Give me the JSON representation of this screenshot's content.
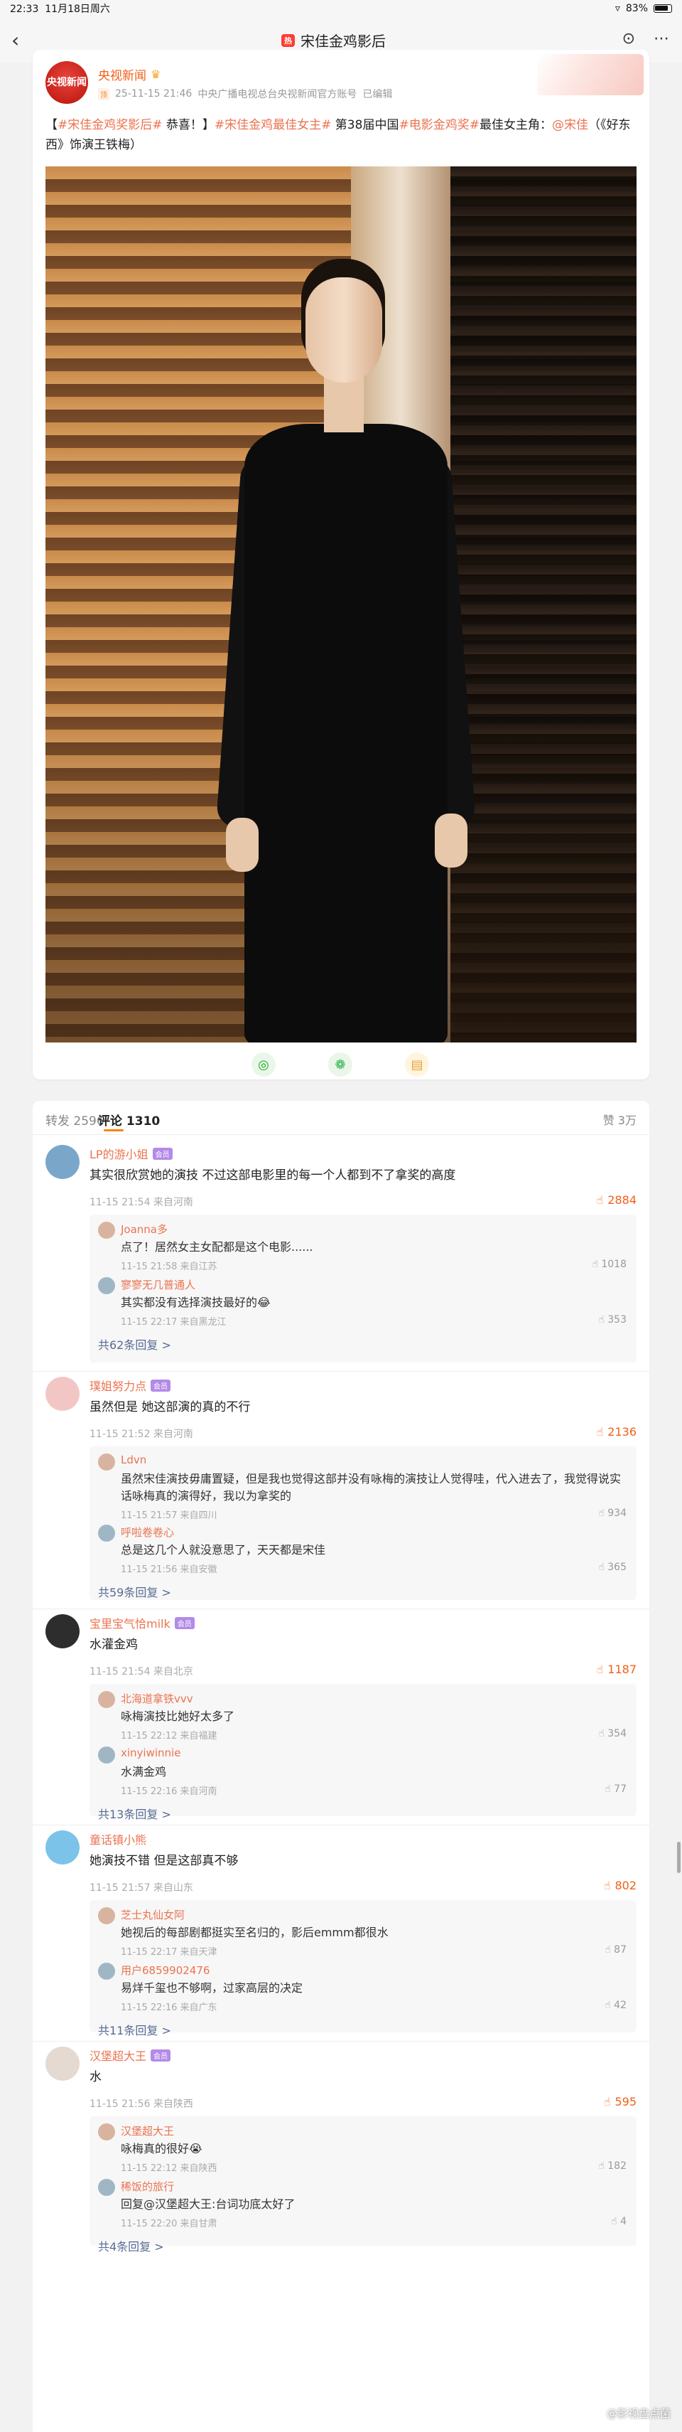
{
  "status_bar": {
    "time": "22:33",
    "date": "11月18日周六",
    "battery": "83%"
  },
  "nav": {
    "hot_badge": "热",
    "title": "宋佳金鸡影后",
    "back_icon": "chevron-left-icon"
  },
  "post": {
    "author": "央视新闻",
    "avatar_text": "央视新闻",
    "top_tag": "顶",
    "meta_time": "25-11-15 21:46",
    "meta_source": "中央广播电视总台央视新闻官方账号",
    "meta_edited": "已编辑",
    "text_parts": [
      {
        "t": "【",
        "c": "plain"
      },
      {
        "t": "#宋佳金鸡奖影后#",
        "c": "tag"
      },
      {
        "t": " 恭喜！】",
        "c": "plain"
      },
      {
        "t": "#宋佳金鸡最佳女主#",
        "c": "tag"
      },
      {
        "t": " 第38届中国",
        "c": "plain"
      },
      {
        "t": "#电影金鸡奖#",
        "c": "tag"
      },
      {
        "t": "最佳女主角：",
        "c": "plain"
      },
      {
        "t": "@宋佳",
        "c": "mention"
      },
      {
        "t": "（《好东西》饰演王铁梅）",
        "c": "plain"
      }
    ]
  },
  "comments_header": {
    "reposts": "转发 2596",
    "comments": "评论 1310",
    "likes": "赞 3万"
  },
  "comments": [
    {
      "name": "LP的游小姐",
      "badge": "会员",
      "text": "其实很欣赏她的演技 不过这部电影里的每一个人都到不了拿奖的高度",
      "meta": "11-15 21:54 来自河南",
      "likes": "2884",
      "replies": [
        {
          "name": "Joanna多",
          "text": "点了！居然女主女配都是这个电影......",
          "meta": "11-15 21:58 来自江苏",
          "likes": "1018"
        },
        {
          "name": "寥寥无几普通人",
          "text": "其实都没有选择演技最好的😂",
          "meta": "11-15 22:17 来自黑龙江",
          "likes": "353"
        }
      ],
      "more": "共62条回复 >"
    },
    {
      "name": "璞姐努力点",
      "badge": "会员",
      "text": "虽然但是 她这部演的真的不行",
      "meta": "11-15 21:52 来自河南",
      "likes": "2136",
      "replies": [
        {
          "name": "Ldvn",
          "text": "虽然宋佳演技毋庸置疑，但是我也觉得这部并没有咏梅的演技让人觉得哇，代入进去了，我觉得说实话咏梅真的演得好，我以为拿奖的",
          "meta": "11-15 21:57 来自四川",
          "likes": "934"
        },
        {
          "name": "呼啦卷卷心",
          "text": "总是这几个人就没意思了，天天都是宋佳",
          "meta": "11-15 21:56 来自安徽",
          "likes": "365"
        }
      ],
      "more": "共59条回复 >"
    },
    {
      "name": "宝里宝气恰milk",
      "badge": "会员",
      "text": "水灌金鸡",
      "meta": "11-15 21:54 来自北京",
      "likes": "1187",
      "replies": [
        {
          "name": "北海道拿铁vvv",
          "text": "咏梅演技比她好太多了",
          "meta": "11-15 22:12 来自福建",
          "likes": "354"
        },
        {
          "name": "xinyiwinnie",
          "text": "水满金鸡",
          "meta": "11-15 22:16 来自河南",
          "likes": "77"
        }
      ],
      "more": "共13条回复 >"
    },
    {
      "name": "童话镇小熊",
      "text": "她演技不错 但是这部真不够",
      "meta": "11-15 21:57 来自山东",
      "likes": "802",
      "replies": [
        {
          "name": "芝士丸仙女阿",
          "text": "她视后的每部剧都挺实至名归的，影后emmm都很水",
          "meta": "11-15 22:17 来自天津",
          "likes": "87"
        },
        {
          "name": "用户6859902476",
          "text": "易烊千玺也不够啊，过家高层的决定",
          "meta": "11-15 22:16 来自广东",
          "likes": "42"
        }
      ],
      "more": "共11条回复 >"
    },
    {
      "name": "汉堡超大王",
      "badge": "会员",
      "text": "水",
      "meta": "11-15 21:56 来自陕西",
      "likes": "595",
      "replies": [
        {
          "name": "汉堡超大王",
          "text": "咏梅真的很好😭",
          "meta": "11-15 22:12 来自陕西",
          "likes": "182"
        },
        {
          "name": "稀饭的旅行",
          "text": "回复@汉堡超大王:台词功底太好了",
          "meta": "11-15 22:20 来自甘肃",
          "likes": "4"
        }
      ],
      "more": "共4条回复 >"
    }
  ],
  "watermark": "@影视盘点菌"
}
